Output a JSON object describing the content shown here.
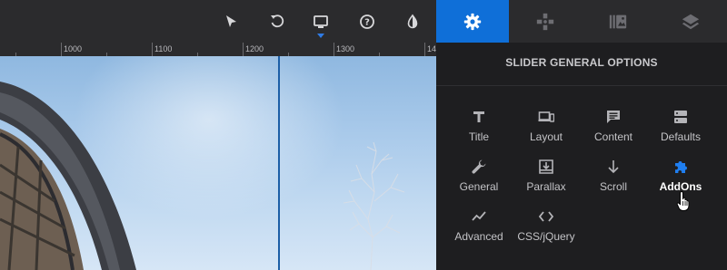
{
  "toolbar": {
    "tools": [
      {
        "icon": "select-pointer-icon"
      },
      {
        "icon": "undo-icon"
      },
      {
        "icon": "desktop-view-icon",
        "selected": true
      },
      {
        "icon": "help-icon"
      },
      {
        "icon": "contrast-icon"
      }
    ]
  },
  "ruler": {
    "labels": [
      "1000",
      "1100",
      "1200",
      "1300",
      "14"
    ]
  },
  "tabs": [
    {
      "icon": "gear-icon",
      "active": true
    },
    {
      "icon": "layers-puzzle-icon",
      "active": false
    },
    {
      "icon": "media-library-icon",
      "active": false
    },
    {
      "icon": "layers-icon",
      "active": false
    }
  ],
  "panel": {
    "title": "SLIDER GENERAL OPTIONS",
    "options": [
      {
        "label": "Title",
        "icon": "title-icon"
      },
      {
        "label": "Layout",
        "icon": "layout-icon"
      },
      {
        "label": "Content",
        "icon": "content-icon"
      },
      {
        "label": "Defaults",
        "icon": "defaults-icon"
      },
      {
        "label": "General",
        "icon": "wrench-icon"
      },
      {
        "label": "Parallax",
        "icon": "parallax-icon"
      },
      {
        "label": "Scroll",
        "icon": "scroll-arrow-icon"
      },
      {
        "label": "AddOns",
        "icon": "puzzle-icon",
        "highlighted": true
      },
      {
        "label": "Advanced",
        "icon": "advanced-chart-icon"
      },
      {
        "label": "CSS/jQuery",
        "icon": "code-icon"
      }
    ]
  },
  "colors": {
    "accent": "#0f6fd8",
    "guide": "#1c5ea6",
    "panel_bg": "#1e1e20",
    "bar_bg": "#2b2b2d"
  }
}
